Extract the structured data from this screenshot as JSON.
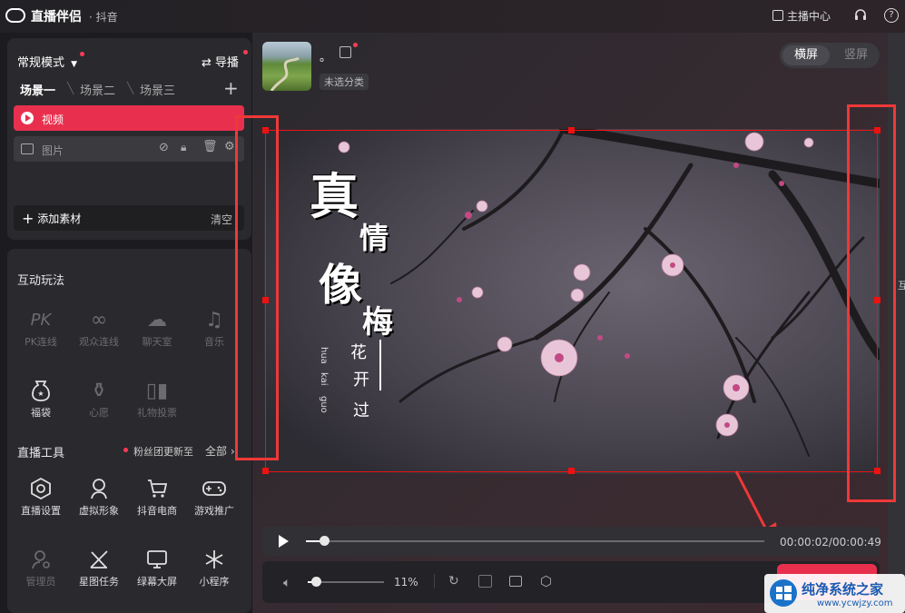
{
  "titlebar": {
    "app_name": "直播伴侣",
    "platform": "· 抖音",
    "center_label": "主播中心"
  },
  "sidebar": {
    "mode_label": "常规模式",
    "guide_label": "导播",
    "scenes": [
      "场景一",
      "场景二",
      "场景三"
    ],
    "sources": [
      {
        "label": "视频",
        "active": true
      },
      {
        "label": "图片",
        "active": false
      }
    ],
    "add_material": "添加素材",
    "clear": "清空",
    "interactive_title": "互动玩法",
    "interactive": [
      {
        "label": "PK连线",
        "icon": "PK",
        "enabled": false
      },
      {
        "label": "观众连线",
        "icon": "link-icon",
        "enabled": false
      },
      {
        "label": "聊天室",
        "icon": "chat-room-icon",
        "enabled": false
      },
      {
        "label": "音乐",
        "icon": "music-icon",
        "enabled": false
      },
      {
        "label": "福袋",
        "icon": "lucky-bag-icon",
        "enabled": true
      },
      {
        "label": "心愿",
        "icon": "wish-icon",
        "enabled": false
      },
      {
        "label": "礼物投票",
        "icon": "gift-vote-icon",
        "enabled": false
      }
    ],
    "tools_title": "直播工具",
    "fan_update": "粉丝团更新至",
    "all_label": "全部",
    "tools": [
      {
        "label": "直播设置",
        "icon": "settings-hex-icon",
        "enabled": true
      },
      {
        "label": "虚拟形象",
        "icon": "avatar-icon",
        "enabled": true
      },
      {
        "label": "抖音电商",
        "icon": "cart-icon",
        "enabled": true
      },
      {
        "label": "游戏推广",
        "icon": "gamepad-icon",
        "enabled": true
      },
      {
        "label": "管理员",
        "icon": "admin-icon",
        "enabled": false
      },
      {
        "label": "星图任务",
        "icon": "star-task-icon",
        "enabled": true
      },
      {
        "label": "绿幕大屏",
        "icon": "screen-icon",
        "enabled": true
      },
      {
        "label": "小程序",
        "icon": "mini-program-icon",
        "enabled": true
      }
    ]
  },
  "header": {
    "username": "。",
    "category": "未选分类",
    "orientation_on": "横屏",
    "orientation_off": "竖屏"
  },
  "stage": {
    "title_chars": [
      "真",
      "情",
      "像",
      "梅"
    ],
    "sub_chars": [
      "花",
      "开",
      "过"
    ],
    "pinyin": [
      "hua",
      "kai",
      "guo"
    ]
  },
  "player": {
    "time": "00:00:02/00:00:49",
    "progress": 0.04
  },
  "controls": {
    "volume": "11%",
    "volume_level": 0.11
  },
  "watermark": {
    "brand": "纯净系统之家",
    "url": "www.ycwjzy.com"
  },
  "right_label": "互",
  "colors": {
    "accent": "#e8304e",
    "highlight": "#f03838"
  }
}
